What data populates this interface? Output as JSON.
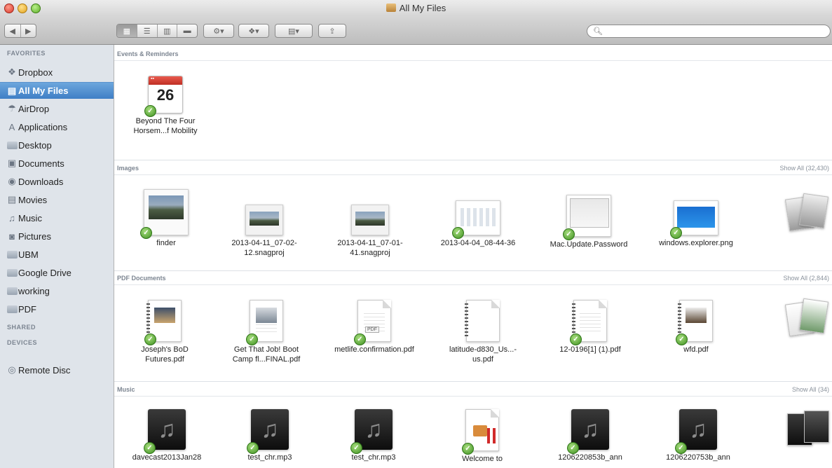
{
  "window": {
    "title": "All My Files"
  },
  "search": {
    "placeholder": "",
    "value": ""
  },
  "toolbar": {
    "back_icon": "back-arrow",
    "forward_icon": "forward-arrow",
    "view_modes": [
      "icon-view",
      "list-view",
      "column-view",
      "coverflow-view"
    ],
    "active_view": "icon-view"
  },
  "sidebar": {
    "favorites_label": "FAVORITES",
    "favorites": [
      {
        "label": "Dropbox",
        "icon": "dropbox-icon"
      },
      {
        "label": "All My Files",
        "icon": "all-my-files-icon",
        "selected": true
      },
      {
        "label": "AirDrop",
        "icon": "airdrop-icon"
      },
      {
        "label": "Applications",
        "icon": "applications-icon"
      },
      {
        "label": "Desktop",
        "icon": "desktop-icon"
      },
      {
        "label": "Documents",
        "icon": "documents-icon"
      },
      {
        "label": "Downloads",
        "icon": "downloads-icon"
      },
      {
        "label": "Movies",
        "icon": "movies-icon"
      },
      {
        "label": "Music",
        "icon": "music-icon"
      },
      {
        "label": "Pictures",
        "icon": "pictures-icon"
      },
      {
        "label": "UBM",
        "icon": "folder-icon"
      },
      {
        "label": "Google Drive",
        "icon": "folder-icon"
      },
      {
        "label": "working",
        "icon": "folder-icon"
      },
      {
        "label": "PDF",
        "icon": "folder-icon"
      }
    ],
    "shared_label": "SHARED",
    "devices_label": "DEVICES",
    "devices": [
      {
        "label": "Remote Disc",
        "icon": "remote-disc-icon"
      }
    ]
  },
  "sections": {
    "events": {
      "title": "Events & Reminders",
      "items": [
        {
          "name": "Beyond The Four Horsem...f Mobility",
          "day": "26"
        }
      ]
    },
    "images": {
      "title": "Images",
      "show_all": "Show All (32,430)",
      "items": [
        {
          "name": "finder"
        },
        {
          "name": "2013-04-11_07-02-12.snagproj"
        },
        {
          "name": "2013-04-11_07-01-41.snagproj"
        },
        {
          "name": "2013-04-04_08-44-36"
        },
        {
          "name": "Mac.Update.Password"
        },
        {
          "name": "windows.explorer.png"
        }
      ]
    },
    "pdf": {
      "title": "PDF Documents",
      "show_all": "Show All (2,844)",
      "items": [
        {
          "name": "Joseph's BoD Futures.pdf"
        },
        {
          "name": "Get That Job! Boot Camp fl...FINAL.pdf"
        },
        {
          "name": "metlife.confirmation.pdf",
          "tag": "PDF"
        },
        {
          "name": "latitude-d830_Us...-us.pdf"
        },
        {
          "name": "12-0196[1] (1).pdf"
        },
        {
          "name": "wfd.pdf"
        }
      ]
    },
    "music": {
      "title": "Music",
      "show_all": "Show All (34)",
      "items": [
        {
          "name": "davecast2013Jan28"
        },
        {
          "name": "test_chr.mp3"
        },
        {
          "name": "test_chr.mp3"
        },
        {
          "name": "Welcome to"
        },
        {
          "name": "1206220853b_ann"
        },
        {
          "name": "1206220753b_ann"
        }
      ]
    }
  }
}
